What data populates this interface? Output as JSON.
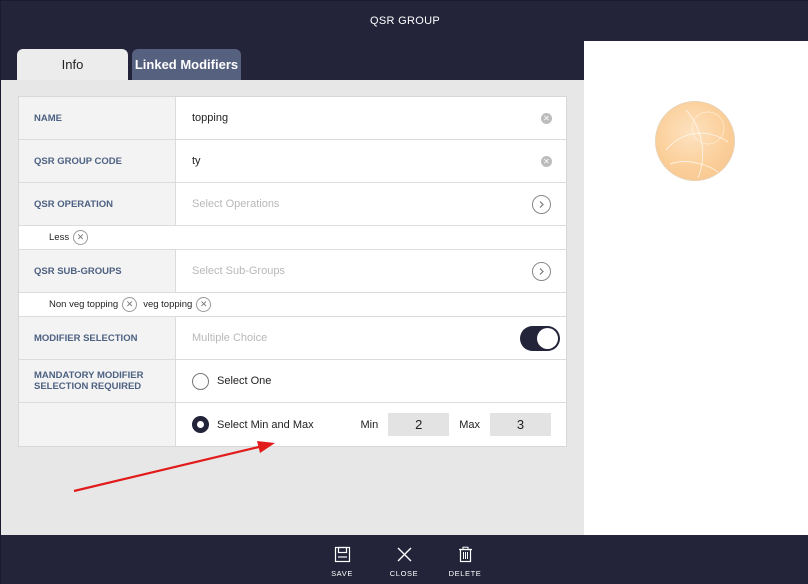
{
  "window": {
    "title": "QSR GROUP"
  },
  "tabs": [
    {
      "label": "Info",
      "active": true
    },
    {
      "label": "Linked Modifiers",
      "active": false
    }
  ],
  "form": {
    "name": {
      "label": "NAME",
      "value": "topping"
    },
    "group_code": {
      "label": "QSR GROUP CODE",
      "value": "ty"
    },
    "operation": {
      "label": "QSR OPERATION",
      "placeholder": "Select Operations",
      "chips": [
        "Less"
      ]
    },
    "sub_groups": {
      "label": "QSR SUB-GROUPS",
      "placeholder": "Select Sub-Groups",
      "chips": [
        "Non veg topping",
        "veg topping"
      ]
    },
    "modifier_selection": {
      "label": "MODIFIER SELECTION",
      "placeholder": "Multiple Choice",
      "toggle_on": true
    },
    "mandatory": {
      "label": "MANDATORY MODIFIER SELECTION REQUIRED",
      "option_one": "Select One",
      "option_minmax": "Select Min and Max",
      "selected": "minmax",
      "min_label": "Min",
      "min_value": "2",
      "max_label": "Max",
      "max_value": "3"
    }
  },
  "footer": {
    "save": "SAVE",
    "close": "CLOSE",
    "delete": "DELETE"
  },
  "colors": {
    "dark": "#23233a",
    "tab_linked": "#56607f",
    "label_text": "#4d6182",
    "annotation_arrow": "#e21b1b"
  }
}
